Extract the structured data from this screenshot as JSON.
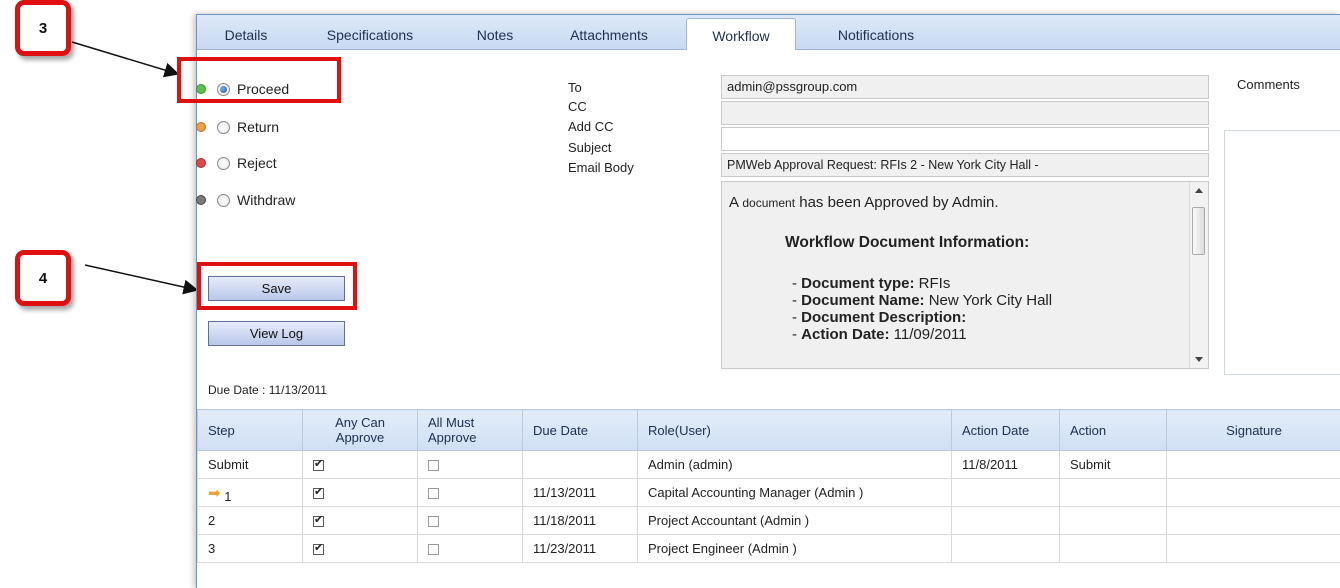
{
  "callouts": {
    "step3": "3",
    "step4": "4"
  },
  "tabs": [
    {
      "label": "Details"
    },
    {
      "label": "Specifications"
    },
    {
      "label": "Notes"
    },
    {
      "label": "Attachments"
    },
    {
      "label": "Workflow",
      "active": true
    },
    {
      "label": "Notifications"
    }
  ],
  "actions": {
    "proceed": "Proceed",
    "return": "Return",
    "reject": "Reject",
    "withdraw": "Withdraw",
    "selected": "Proceed",
    "colors": {
      "proceed": "#5cc24a",
      "return": "#f0a040",
      "reject": "#e04a4a",
      "withdraw": "#7a7a7a"
    }
  },
  "buttons": {
    "save": "Save",
    "view_log": "View Log"
  },
  "email": {
    "to_label": "To",
    "cc_label": "CC",
    "add_cc_label": "Add CC",
    "subject_label": "Subject",
    "body_label": "Email Body",
    "to_value": "admin@pssgroup.com",
    "cc_value": "",
    "add_cc_value": "",
    "subject_value": "PMWeb Approval Request:  RFIs 2 - New York City Hall -",
    "body": {
      "intro_a": "A ",
      "intro_link": "document",
      "intro_b": " has been Approved by Admin.",
      "heading": "Workflow Document Information:",
      "lines": [
        {
          "key": "Document type:",
          "value": " RFIs"
        },
        {
          "key": "Document Name:",
          "value": " New York City Hall"
        },
        {
          "key": "Document Description:",
          "value": ""
        },
        {
          "key": "Action Date:",
          "value": " 11/09/2011"
        }
      ]
    }
  },
  "comments_label": "Comments",
  "due_date": "Due Date : 11/13/2011",
  "table": {
    "headers": {
      "step": "Step",
      "any": "Any Can Approve",
      "all": "All Must Approve",
      "due": "Due Date",
      "role": "Role(User)",
      "action_date": "Action Date",
      "action": "Action",
      "signature": "Signature"
    },
    "rows": [
      {
        "step": "Submit",
        "any": true,
        "all": false,
        "due": "",
        "role": "Admin (admin)",
        "action_date": "11/8/2011",
        "action": "Submit",
        "signature": "",
        "current": false
      },
      {
        "step": "1",
        "any": true,
        "all": false,
        "due": "11/13/2011",
        "role": "Capital Accounting Manager (Admin )",
        "action_date": "",
        "action": "",
        "signature": "",
        "current": true
      },
      {
        "step": "2",
        "any": true,
        "all": false,
        "due": "11/18/2011",
        "role": "Project Accountant (Admin )",
        "action_date": "",
        "action": "",
        "signature": "",
        "current": false
      },
      {
        "step": "3",
        "any": true,
        "all": false,
        "due": "11/23/2011",
        "role": "Project Engineer (Admin )",
        "action_date": "",
        "action": "",
        "signature": "",
        "current": false
      }
    ]
  }
}
